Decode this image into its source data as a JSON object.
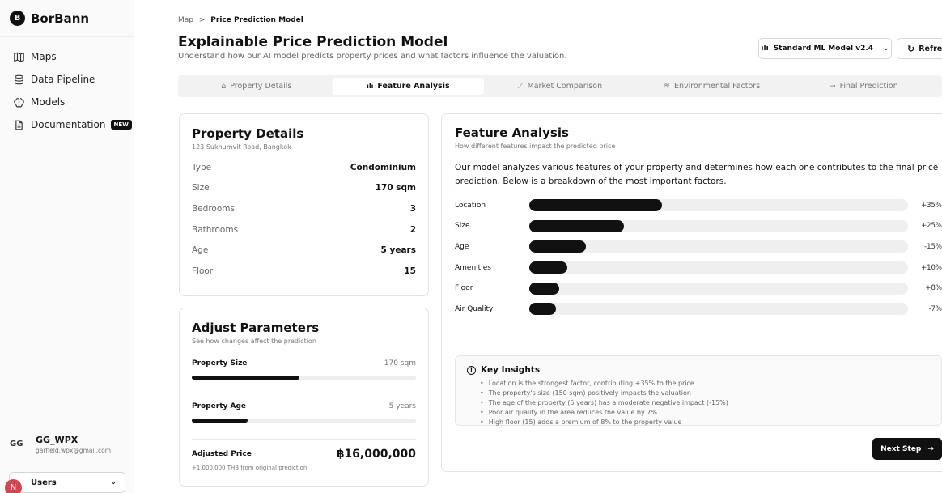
{
  "brand": {
    "logo_letter": "B",
    "name": "BorBann"
  },
  "sidebar": {
    "items": [
      {
        "label": "Maps",
        "icon": "map-icon"
      },
      {
        "label": "Data Pipeline",
        "icon": "database-icon"
      },
      {
        "label": "Models",
        "icon": "brain-icon"
      },
      {
        "label": "Documentation",
        "icon": "document-icon",
        "badge": "NEW"
      }
    ],
    "user": {
      "initials": "GG",
      "name": "GG_WPX",
      "email": "garfield.wpx@gmail.com"
    },
    "switcher": {
      "label": "Users",
      "avatar": "N"
    }
  },
  "header": {
    "breadcrumb_root": "Map",
    "breadcrumb_sep": ">",
    "breadcrumb_current": "Price Prediction Model",
    "title": "Explainable Price Prediction Model",
    "subtitle": "Understand how our AI model predicts property prices and what factors influence the valuation.",
    "model_select": "Standard ML Model v2.4",
    "refresh_label": "Refresh"
  },
  "tabs": [
    {
      "label": "Property Details",
      "icon": "home-icon"
    },
    {
      "label": "Feature Analysis",
      "icon": "bar-chart-icon",
      "active": true
    },
    {
      "label": "Market Comparison",
      "icon": "line-chart-icon"
    },
    {
      "label": "Environmental Factors",
      "icon": "wind-icon"
    },
    {
      "label": "Final Prediction",
      "icon": "arrow-right-icon"
    }
  ],
  "property": {
    "title": "Property Details",
    "address": "123 Sukhumvit Road, Bangkok",
    "rows": [
      {
        "k": "Type",
        "v": "Condominium"
      },
      {
        "k": "Size",
        "v": "170 sqm"
      },
      {
        "k": "Bedrooms",
        "v": "3"
      },
      {
        "k": "Bathrooms",
        "v": "2"
      },
      {
        "k": "Age",
        "v": "5 years"
      },
      {
        "k": "Floor",
        "v": "15"
      }
    ]
  },
  "adjust": {
    "title": "Adjust Parameters",
    "subtitle": "See how changes affect the prediction",
    "params": [
      {
        "label": "Property Size",
        "value": "170 sqm",
        "fraction": 0.48
      },
      {
        "label": "Property Age",
        "value": "5 years",
        "fraction": 0.25
      }
    ],
    "price_label": "Adjusted Price",
    "price_value": "฿16,000,000",
    "note": "+1,000,000 THB from original prediction"
  },
  "analysis": {
    "title": "Feature Analysis",
    "subtitle": "How different features impact the predicted price",
    "description": "Our model analyzes various features of your property and determines how each one contributes to the final price prediction. Below is a breakdown of the most important factors.",
    "features": [
      {
        "name": "Location",
        "value": "+35%",
        "fraction": 0.35
      },
      {
        "name": "Size",
        "value": "+25%",
        "fraction": 0.25
      },
      {
        "name": "Age",
        "value": "-15%",
        "fraction": 0.15
      },
      {
        "name": "Amenities",
        "value": "+10%",
        "fraction": 0.1
      },
      {
        "name": "Floor",
        "value": "+8%",
        "fraction": 0.08
      },
      {
        "name": "Air Quality",
        "value": "-7%",
        "fraction": 0.07
      }
    ],
    "insights_title": "Key Insights",
    "insights": [
      "Location is the strongest factor, contributing +35% to the price",
      "The property's size (150 sqm) positively impacts the valuation",
      "The age of the property (5 years) has a moderate negative impact (-15%)",
      "Poor air quality in the area reduces the value by 7%",
      "High floor (15) adds a premium of 8% to the property value"
    ],
    "next_label": "Next Step"
  }
}
